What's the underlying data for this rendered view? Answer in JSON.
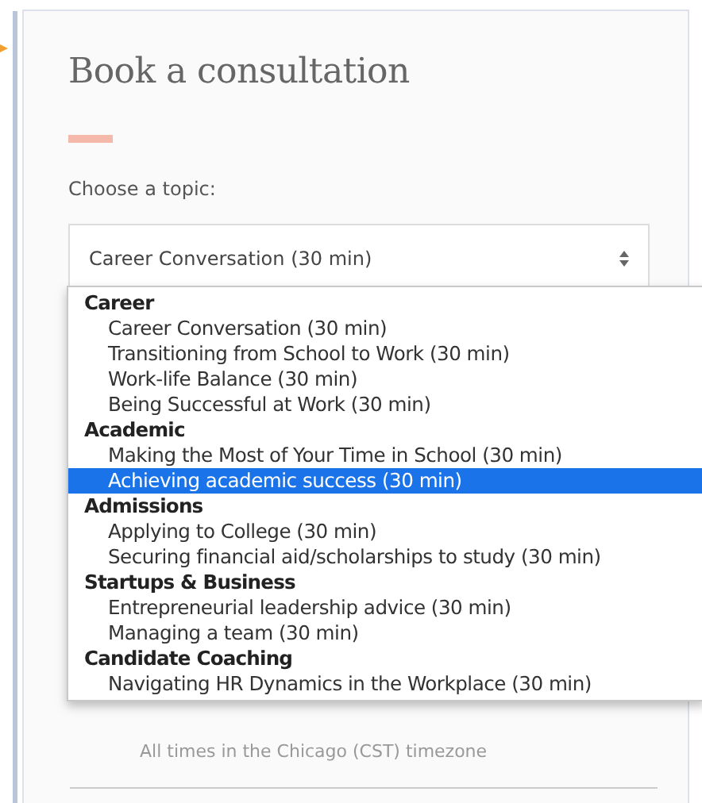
{
  "title": "Book a consultation",
  "topic_label": "Choose a topic:",
  "topic_select": {
    "value": "Career Conversation (30 min)"
  },
  "dropdown": {
    "groups": [
      {
        "label": "Career",
        "options": [
          {
            "label": "Career Conversation (30 min)",
            "selected": false
          },
          {
            "label": "Transitioning from School to Work (30 min)",
            "selected": false
          },
          {
            "label": "Work-life Balance (30 min)",
            "selected": false
          },
          {
            "label": "Being Successful at Work (30 min)",
            "selected": false
          }
        ]
      },
      {
        "label": "Academic",
        "options": [
          {
            "label": "Making the Most of Your Time in School (30 min)",
            "selected": false
          },
          {
            "label": "Achieving academic success (30 min)",
            "selected": true
          }
        ]
      },
      {
        "label": "Admissions",
        "options": [
          {
            "label": "Applying to College (30 min)",
            "selected": false
          },
          {
            "label": "Securing financial aid/scholarships to study (30 min)",
            "selected": false
          }
        ]
      },
      {
        "label": "Startups & Business",
        "options": [
          {
            "label": "Entrepreneurial leadership advice (30 min)",
            "selected": false
          },
          {
            "label": "Managing a team (30 min)",
            "selected": false
          }
        ]
      },
      {
        "label": "Candidate Coaching",
        "options": [
          {
            "label": "Navigating HR Dynamics in the Workplace (30 min)",
            "selected": false
          }
        ]
      }
    ]
  },
  "timezone_note": "All times in the Chicago (CST) timezone"
}
